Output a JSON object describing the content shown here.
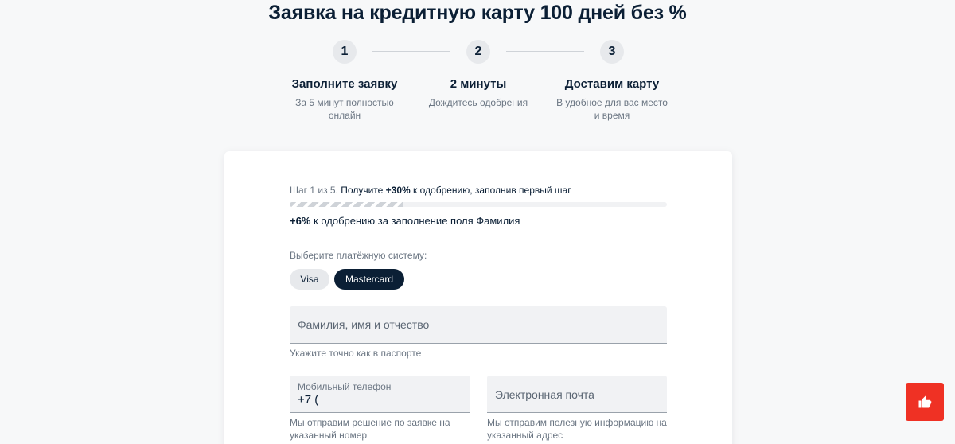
{
  "page": {
    "title": "Заявка на кредитную карту 100 дней без %"
  },
  "steps": [
    {
      "number": "1",
      "title": "Заполните заявку",
      "desc": "За 5 минут полностью онлайн"
    },
    {
      "number": "2",
      "title": "2 минуты",
      "desc": "Дождитесь одобрения"
    },
    {
      "number": "3",
      "title": "Доставим карту",
      "desc": "В удобное для вас место и время"
    }
  ],
  "form": {
    "progress_step": "Шаг 1 из 5.",
    "progress_prefix": "Получите",
    "progress_bold": "+30%",
    "progress_suffix": "к одобрению, заполнив первый шаг",
    "progress_value": 0.3,
    "bonus_bold": "+6%",
    "bonus_text": "к одобрению за заполнение поля Фамилия",
    "payment_label": "Выберите платёжную систему:",
    "payment_options": [
      "Visa",
      "Mastercard"
    ],
    "payment_selected": "Mastercard",
    "fio_placeholder": "Фамилия, имя и отчество",
    "fio_hint": "Укажите точно как в паспорте",
    "phone_label": "Мобильный телефон",
    "phone_value": "+7 (",
    "phone_hint": "Мы отправим решение по заявке на указанный номер",
    "email_placeholder": "Электронная почта",
    "email_hint": "Мы отправим полезную информацию на указанный адрес"
  },
  "colors": {
    "accent": "#ef3124",
    "dark": "#0b1f35"
  },
  "icons": {
    "feedback": "thumbs-up-icon"
  }
}
